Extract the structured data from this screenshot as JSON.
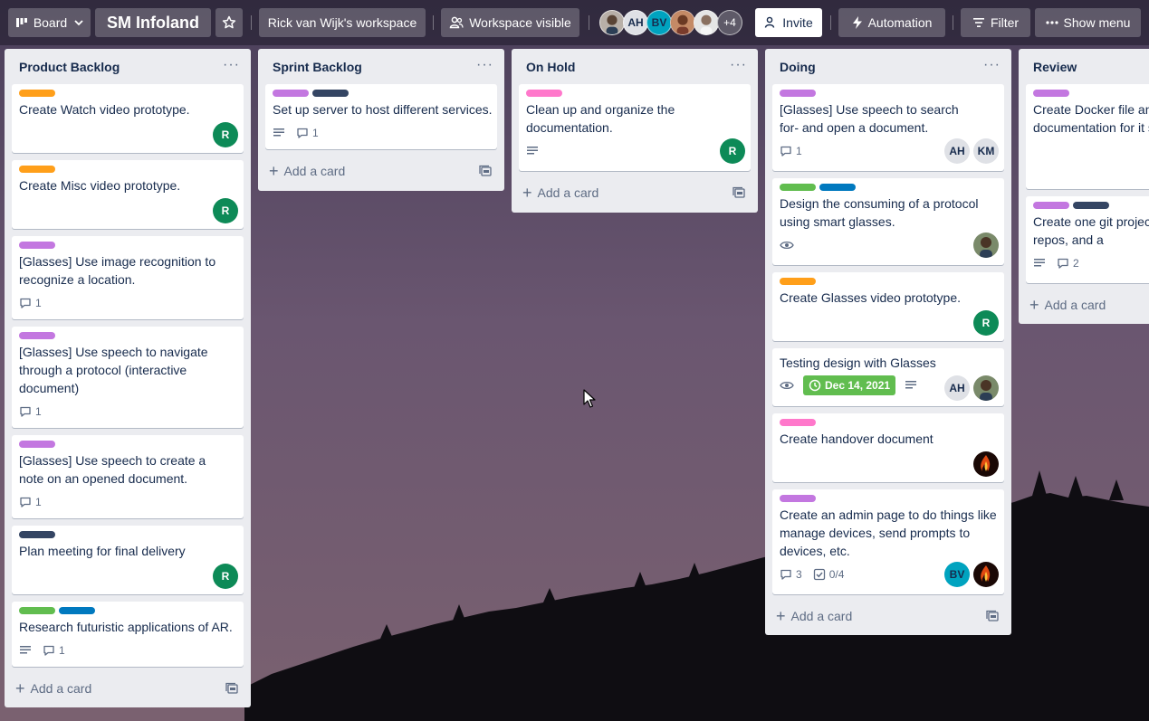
{
  "header": {
    "view_label": "Board",
    "board_title": "SM Infoland",
    "workspace_label": "Rick van Wijk's workspace",
    "visibility_label": "Workspace visible",
    "members_more": "+4",
    "member_initials": [
      "AH",
      "BV"
    ],
    "invite_label": "Invite",
    "automation_label": "Automation",
    "filter_label": "Filter",
    "show_menu_label": "Show menu"
  },
  "colors": {
    "orange": "#ff9f1a",
    "purple": "#c377e0",
    "navy": "#344563",
    "pink": "#ff78cb",
    "green": "#61bd4f",
    "blue": "#0079bf",
    "avatar_green": "#0d8a57",
    "avatar_teal": "#00a3bf"
  },
  "lists": [
    {
      "title": "Product Backlog",
      "add_label": "Add a card",
      "cards": [
        {
          "labels": [
            "orange"
          ],
          "text": "Create Watch video prototype.",
          "members": [
            "R"
          ]
        },
        {
          "labels": [
            "orange"
          ],
          "text": "Create Misc video prototype.",
          "members": [
            "R"
          ]
        },
        {
          "labels": [
            "purple"
          ],
          "text": "[Glasses] Use image recognition to recognize a location.",
          "comments": "1"
        },
        {
          "labels": [
            "purple"
          ],
          "text": "[Glasses] Use speech to navigate through a protocol (interactive document)",
          "comments": "1"
        },
        {
          "labels": [
            "purple"
          ],
          "text": "[Glasses] Use speech to create a note on an opened document.",
          "comments": "1"
        },
        {
          "labels": [
            "navy"
          ],
          "text": "Plan meeting for final delivery",
          "members": [
            "R"
          ]
        },
        {
          "labels": [
            "green",
            "blue"
          ],
          "text": "Research futuristic applications of AR.",
          "description": true,
          "comments": "1"
        }
      ]
    },
    {
      "title": "Sprint Backlog",
      "add_label": "Add a card",
      "cards": [
        {
          "labels": [
            "purple",
            "navy"
          ],
          "text": "Set up server to host different services.",
          "description": true,
          "comments": "1"
        }
      ]
    },
    {
      "title": "On Hold",
      "add_label": "Add a card",
      "cards": [
        {
          "labels": [
            "pink"
          ],
          "text": "Clean up and organize the documentation.",
          "description": true,
          "members": [
            "R"
          ]
        }
      ]
    },
    {
      "title": "Doing",
      "add_label": "Add a card",
      "cards": [
        {
          "labels": [
            "purple"
          ],
          "text": "[Glasses] Use speech to search for- and open a document.",
          "comments": "1",
          "members": [
            "AH",
            "KM"
          ]
        },
        {
          "labels": [
            "green",
            "blue"
          ],
          "text": "Design the consuming of a protocol using smart glasses.",
          "watching": true,
          "members": [
            "photo"
          ]
        },
        {
          "labels": [
            "orange"
          ],
          "text": "Create Glasses video prototype.",
          "members": [
            "R"
          ]
        },
        {
          "labels": [],
          "text": "Testing design with Glasses",
          "watching": true,
          "due": "Dec 14, 2021",
          "description": true,
          "members": [
            "AH",
            "photo"
          ]
        },
        {
          "labels": [
            "pink"
          ],
          "text": "Create handover document",
          "members": [
            "flame"
          ]
        },
        {
          "labels": [
            "purple"
          ],
          "text": "Create an admin page to do things like manage devices, send prompts to devices, etc.",
          "comments": "3",
          "checklist": "0/4",
          "members": [
            "BV",
            "flame"
          ]
        }
      ]
    },
    {
      "title": "Review",
      "add_label": "Add a card",
      "cards": [
        {
          "labels": [
            "purple"
          ],
          "text": "Create Docker file and documentation for it service."
        },
        {
          "labels": [
            "purple",
            "navy"
          ],
          "text": "Create one git project different repos, and a",
          "description": true,
          "comments": "2"
        }
      ]
    }
  ]
}
